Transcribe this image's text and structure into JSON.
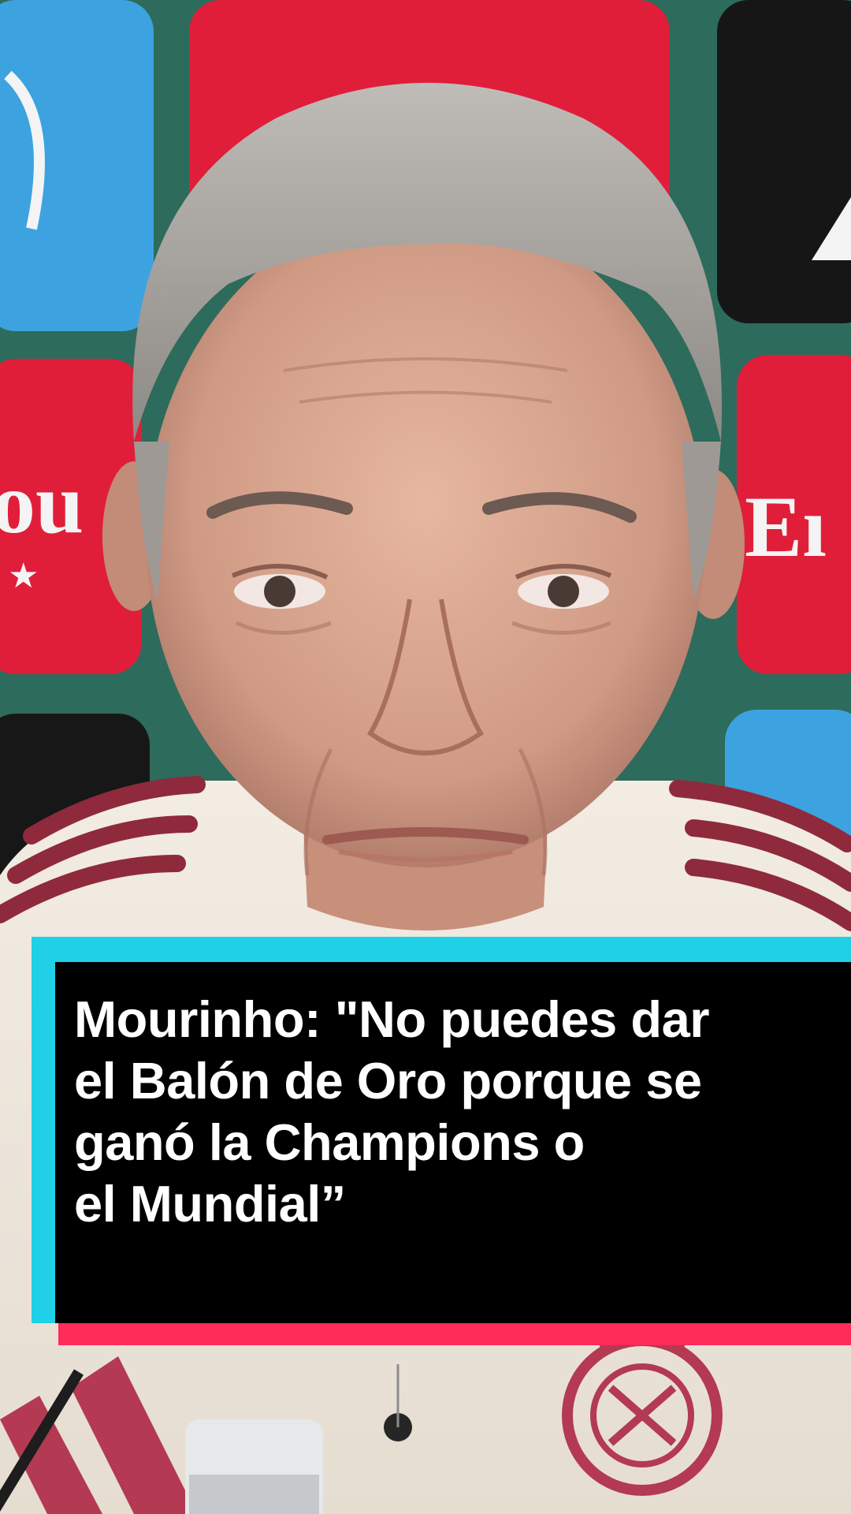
{
  "caption": {
    "lines": [
      "Mourinho: \"No puedes dar",
      "el Balón de Oro porque se",
      "ganó la Champions o",
      "el Mundial”"
    ]
  },
  "colors": {
    "frame_accent": "#1fd0e6",
    "underline_accent": "#ff2b58",
    "panel_background": "#000000",
    "caption_text": "#ffffff"
  },
  "icons": [
    "real-madrid-crest-icon",
    "sponsor-star-icon"
  ]
}
